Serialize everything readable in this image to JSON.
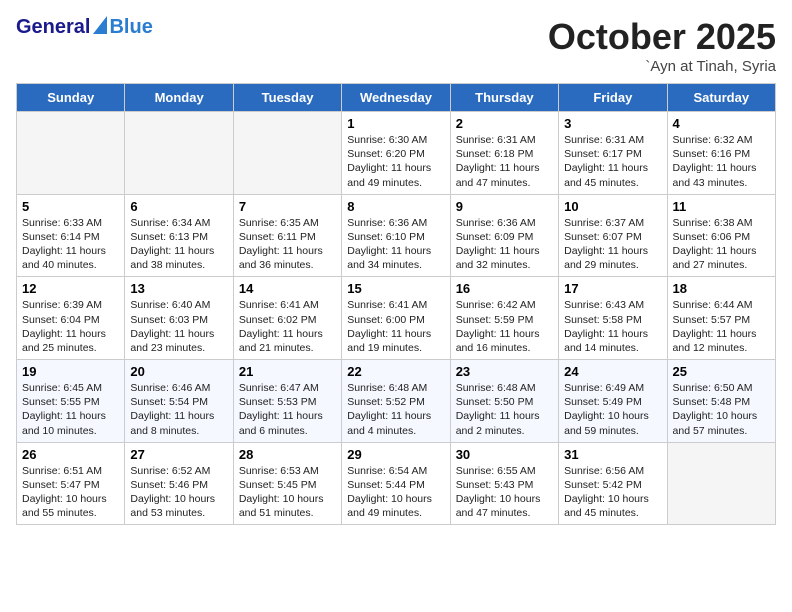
{
  "header": {
    "logo_general": "General",
    "logo_blue": "Blue",
    "month": "October 2025",
    "location": "`Ayn at Tinah, Syria"
  },
  "weekdays": [
    "Sunday",
    "Monday",
    "Tuesday",
    "Wednesday",
    "Thursday",
    "Friday",
    "Saturday"
  ],
  "weeks": [
    [
      {
        "day": "",
        "info": ""
      },
      {
        "day": "",
        "info": ""
      },
      {
        "day": "",
        "info": ""
      },
      {
        "day": "1",
        "info": "Sunrise: 6:30 AM\nSunset: 6:20 PM\nDaylight: 11 hours and 49 minutes."
      },
      {
        "day": "2",
        "info": "Sunrise: 6:31 AM\nSunset: 6:18 PM\nDaylight: 11 hours and 47 minutes."
      },
      {
        "day": "3",
        "info": "Sunrise: 6:31 AM\nSunset: 6:17 PM\nDaylight: 11 hours and 45 minutes."
      },
      {
        "day": "4",
        "info": "Sunrise: 6:32 AM\nSunset: 6:16 PM\nDaylight: 11 hours and 43 minutes."
      }
    ],
    [
      {
        "day": "5",
        "info": "Sunrise: 6:33 AM\nSunset: 6:14 PM\nDaylight: 11 hours and 40 minutes."
      },
      {
        "day": "6",
        "info": "Sunrise: 6:34 AM\nSunset: 6:13 PM\nDaylight: 11 hours and 38 minutes."
      },
      {
        "day": "7",
        "info": "Sunrise: 6:35 AM\nSunset: 6:11 PM\nDaylight: 11 hours and 36 minutes."
      },
      {
        "day": "8",
        "info": "Sunrise: 6:36 AM\nSunset: 6:10 PM\nDaylight: 11 hours and 34 minutes."
      },
      {
        "day": "9",
        "info": "Sunrise: 6:36 AM\nSunset: 6:09 PM\nDaylight: 11 hours and 32 minutes."
      },
      {
        "day": "10",
        "info": "Sunrise: 6:37 AM\nSunset: 6:07 PM\nDaylight: 11 hours and 29 minutes."
      },
      {
        "day": "11",
        "info": "Sunrise: 6:38 AM\nSunset: 6:06 PM\nDaylight: 11 hours and 27 minutes."
      }
    ],
    [
      {
        "day": "12",
        "info": "Sunrise: 6:39 AM\nSunset: 6:04 PM\nDaylight: 11 hours and 25 minutes."
      },
      {
        "day": "13",
        "info": "Sunrise: 6:40 AM\nSunset: 6:03 PM\nDaylight: 11 hours and 23 minutes."
      },
      {
        "day": "14",
        "info": "Sunrise: 6:41 AM\nSunset: 6:02 PM\nDaylight: 11 hours and 21 minutes."
      },
      {
        "day": "15",
        "info": "Sunrise: 6:41 AM\nSunset: 6:00 PM\nDaylight: 11 hours and 19 minutes."
      },
      {
        "day": "16",
        "info": "Sunrise: 6:42 AM\nSunset: 5:59 PM\nDaylight: 11 hours and 16 minutes."
      },
      {
        "day": "17",
        "info": "Sunrise: 6:43 AM\nSunset: 5:58 PM\nDaylight: 11 hours and 14 minutes."
      },
      {
        "day": "18",
        "info": "Sunrise: 6:44 AM\nSunset: 5:57 PM\nDaylight: 11 hours and 12 minutes."
      }
    ],
    [
      {
        "day": "19",
        "info": "Sunrise: 6:45 AM\nSunset: 5:55 PM\nDaylight: 11 hours and 10 minutes."
      },
      {
        "day": "20",
        "info": "Sunrise: 6:46 AM\nSunset: 5:54 PM\nDaylight: 11 hours and 8 minutes."
      },
      {
        "day": "21",
        "info": "Sunrise: 6:47 AM\nSunset: 5:53 PM\nDaylight: 11 hours and 6 minutes."
      },
      {
        "day": "22",
        "info": "Sunrise: 6:48 AM\nSunset: 5:52 PM\nDaylight: 11 hours and 4 minutes."
      },
      {
        "day": "23",
        "info": "Sunrise: 6:48 AM\nSunset: 5:50 PM\nDaylight: 11 hours and 2 minutes."
      },
      {
        "day": "24",
        "info": "Sunrise: 6:49 AM\nSunset: 5:49 PM\nDaylight: 10 hours and 59 minutes."
      },
      {
        "day": "25",
        "info": "Sunrise: 6:50 AM\nSunset: 5:48 PM\nDaylight: 10 hours and 57 minutes."
      }
    ],
    [
      {
        "day": "26",
        "info": "Sunrise: 6:51 AM\nSunset: 5:47 PM\nDaylight: 10 hours and 55 minutes."
      },
      {
        "day": "27",
        "info": "Sunrise: 6:52 AM\nSunset: 5:46 PM\nDaylight: 10 hours and 53 minutes."
      },
      {
        "day": "28",
        "info": "Sunrise: 6:53 AM\nSunset: 5:45 PM\nDaylight: 10 hours and 51 minutes."
      },
      {
        "day": "29",
        "info": "Sunrise: 6:54 AM\nSunset: 5:44 PM\nDaylight: 10 hours and 49 minutes."
      },
      {
        "day": "30",
        "info": "Sunrise: 6:55 AM\nSunset: 5:43 PM\nDaylight: 10 hours and 47 minutes."
      },
      {
        "day": "31",
        "info": "Sunrise: 6:56 AM\nSunset: 5:42 PM\nDaylight: 10 hours and 45 minutes."
      },
      {
        "day": "",
        "info": ""
      }
    ]
  ]
}
